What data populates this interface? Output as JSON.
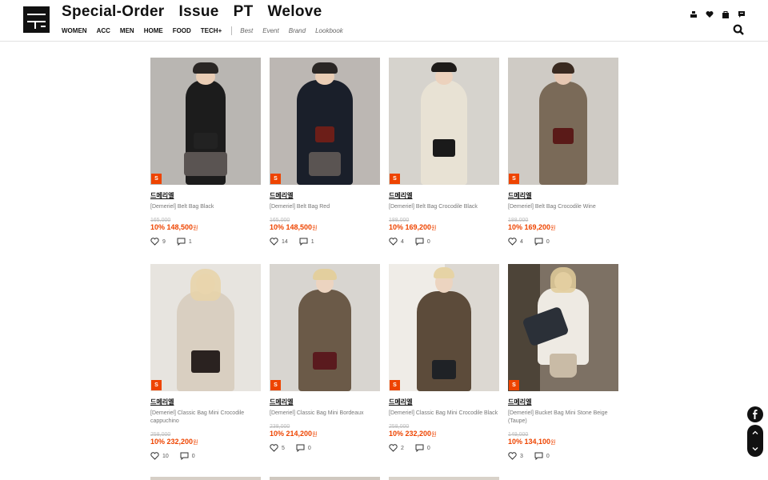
{
  "header": {
    "top_menu": [
      "Special-Order",
      "Issue",
      "PT",
      "Welove"
    ],
    "categories": [
      "WOMEN",
      "ACC",
      "MEN",
      "HOME",
      "FOOD",
      "TECH+"
    ],
    "secondary": [
      "Best",
      "Event",
      "Brand",
      "Lookbook"
    ]
  },
  "products": [
    {
      "badge": "S",
      "brand": "드메리엘",
      "name": "[Demeriel] Belt Bag Black",
      "orig": "165,000",
      "discount": "10%",
      "price": "148,500",
      "unit": "원",
      "likes": "9",
      "comments": "1",
      "bg": "#b9b6b2",
      "dress": "#1c1c1c"
    },
    {
      "badge": "S",
      "brand": "드메리엘",
      "name": "[Demeriel] Belt Bag Red",
      "orig": "165,000",
      "discount": "10%",
      "price": "148,500",
      "unit": "원",
      "likes": "14",
      "comments": "1",
      "bg": "#bcb7b3",
      "dress": "#1a1f2a"
    },
    {
      "badge": "S",
      "brand": "드메리엘",
      "name": "[Demeriel] Belt Bag Crocodile Black",
      "orig": "188,000",
      "discount": "10%",
      "price": "169,200",
      "unit": "원",
      "likes": "4",
      "comments": "0",
      "bg": "#d6d3cd",
      "dress": "#e8e2d4"
    },
    {
      "badge": "S",
      "brand": "드메리엘",
      "name": "[Demeriel] Belt Bag Crocodile Wine",
      "orig": "188,000",
      "discount": "10%",
      "price": "169,200",
      "unit": "원",
      "likes": "4",
      "comments": "0",
      "bg": "#cfcbc5",
      "dress": "#7a6a58"
    },
    {
      "badge": "S",
      "brand": "드메리엘",
      "name": "[Demeriel] Classic Bag Mini Crocodile cappuchino",
      "orig": "258,000",
      "discount": "10%",
      "price": "232,200",
      "unit": "원",
      "likes": "10",
      "comments": "0",
      "bg": "#e7e4df",
      "dress": "#d9cfc1"
    },
    {
      "badge": "S",
      "brand": "드메리엘",
      "name": "[Demeriel] Classic Bag Mini Bordeaux",
      "orig": "238,000",
      "discount": "10%",
      "price": "214,200",
      "unit": "원",
      "likes": "5",
      "comments": "0",
      "bg": "#d8d5d0",
      "dress": "#6b5a48"
    },
    {
      "badge": "S",
      "brand": "드메리엘",
      "name": "[Demeriel] Classic Bag Mini Crocodile Black",
      "orig": "258,000",
      "discount": "10%",
      "price": "232,200",
      "unit": "원",
      "likes": "2",
      "comments": "0",
      "bg": "#dcd8d2",
      "dress": "#5c4b3a"
    },
    {
      "badge": "S",
      "brand": "드메리엘",
      "name": "[Demeriel] Bucket Bag Mini Stone Beige (Taupe)",
      "orig": "149,000",
      "discount": "10%",
      "price": "134,100",
      "unit": "원",
      "likes": "3",
      "comments": "0",
      "bg": "#7d7164",
      "dress": "#eeeae3"
    }
  ]
}
